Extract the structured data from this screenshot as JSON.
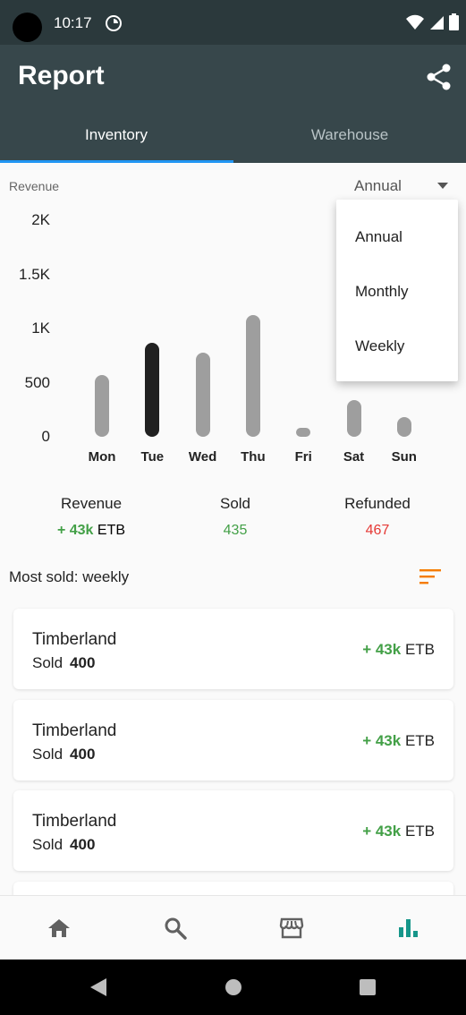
{
  "status_bar": {
    "time": "10:17"
  },
  "app_bar": {
    "title": "Report"
  },
  "tabs": [
    {
      "label": "Inventory",
      "selected": true
    },
    {
      "label": "Warehouse",
      "selected": false
    }
  ],
  "chart_header": {
    "caption": "Revenue",
    "period_selected": "Annual"
  },
  "chart_data": {
    "type": "bar",
    "categories": [
      "Mon",
      "Tue",
      "Wed",
      "Thu",
      "Fri",
      "Sat",
      "Sun"
    ],
    "values": [
      570,
      870,
      780,
      1120,
      80,
      340,
      180
    ],
    "highlighted": "Tue",
    "ylim": [
      0,
      2000
    ],
    "y_ticks": [
      "0",
      "500",
      "1K",
      "1.5K",
      "2K"
    ],
    "title": "",
    "xlabel": "",
    "ylabel": ""
  },
  "dropdown": {
    "items": [
      "Annual",
      "Monthly",
      "Weekly"
    ]
  },
  "summary": {
    "revenue_label": "Revenue",
    "revenue_amount": "+ 43k",
    "revenue_currency": "ETB",
    "sold_label": "Sold",
    "sold_value": "435",
    "refunded_label": "Refunded",
    "refunded_value": "467"
  },
  "most_sold": {
    "title": "Most sold: weekly",
    "items": [
      {
        "name": "Timberland",
        "sold_label": "Sold",
        "sold_count": "400",
        "amount": "+ 43k",
        "currency": "ETB"
      },
      {
        "name": "Timberland",
        "sold_label": "Sold",
        "sold_count": "400",
        "amount": "+ 43k",
        "currency": "ETB"
      },
      {
        "name": "Timberland",
        "sold_label": "Sold",
        "sold_count": "400",
        "amount": "+ 43k",
        "currency": "ETB"
      }
    ]
  },
  "bottom_nav": {
    "items": [
      {
        "icon": "home-icon",
        "active": false
      },
      {
        "icon": "search-icon",
        "active": false
      },
      {
        "icon": "store-icon",
        "active": false
      },
      {
        "icon": "bar-chart-icon",
        "active": true
      }
    ],
    "active_color": "#16968a",
    "inactive_color": "#616161"
  },
  "colors": {
    "app_bar": "#37474b",
    "status_bar": "#2b393c",
    "tab_indicator": "#2196f3",
    "positive": "#43a047",
    "negative": "#e53935",
    "sort_icon": "#f57c00"
  }
}
